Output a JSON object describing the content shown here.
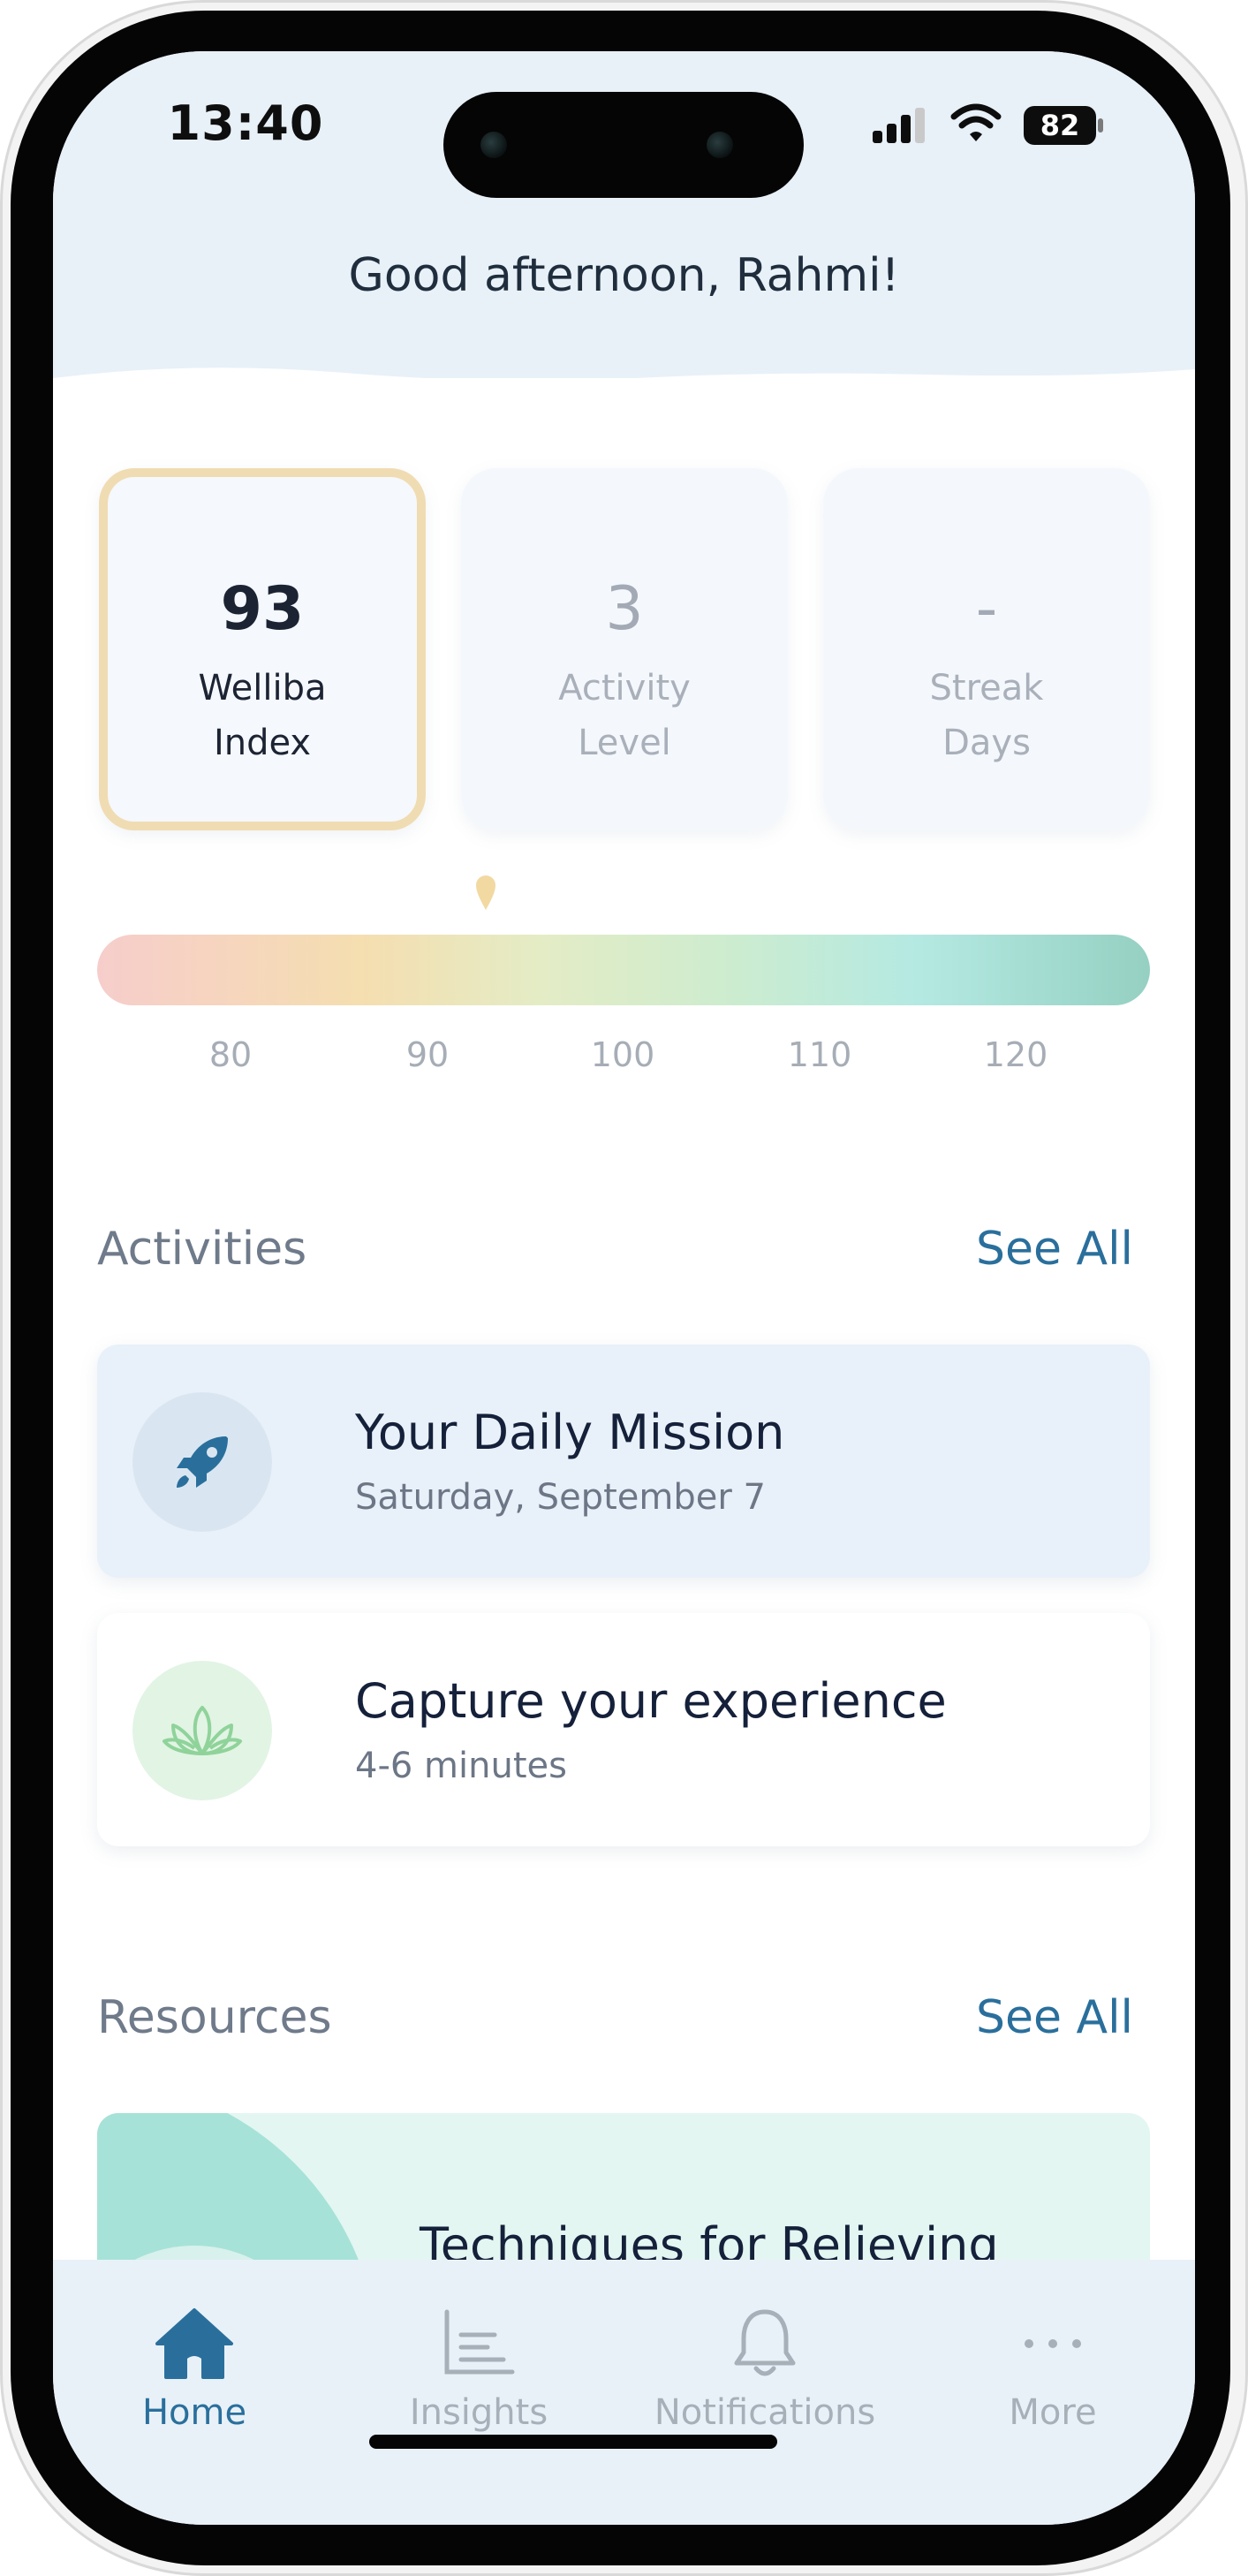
{
  "status_bar": {
    "time": "13:40",
    "battery": "82",
    "icons": [
      "signal-icon",
      "wifi-icon",
      "battery-icon"
    ]
  },
  "greeting": "Good afternoon, Rahmi!",
  "metrics": [
    {
      "value": "93",
      "label_line1": "Welliba",
      "label_line2": "Index",
      "selected": true
    },
    {
      "value": "3",
      "label_line1": "Activity",
      "label_line2": "Level",
      "selected": false
    },
    {
      "value": "-",
      "label_line1": "Streak",
      "label_line2": "Days",
      "selected": false
    }
  ],
  "scale": {
    "ticks": [
      "80",
      "90",
      "100",
      "110",
      "120"
    ],
    "marker_value": 93
  },
  "activities": {
    "title": "Activities",
    "see_all": "See All",
    "items": [
      {
        "title": "Your Daily Mission",
        "subtitle": "Saturday, September 7",
        "icon": "rocket-icon"
      },
      {
        "title": "Capture your experience",
        "subtitle": "4-6 minutes",
        "icon": "lotus-icon"
      }
    ]
  },
  "resources": {
    "title": "Resources",
    "see_all": "See All",
    "items": [
      {
        "title": "Techniques for Relieving"
      }
    ]
  },
  "tabs": [
    {
      "label": "Home",
      "icon": "home-icon",
      "active": true
    },
    {
      "label": "Insights",
      "icon": "insights-icon",
      "active": false
    },
    {
      "label": "Notifications",
      "icon": "bell-icon",
      "active": false
    },
    {
      "label": "More",
      "icon": "more-icon",
      "active": false
    }
  ],
  "colors": {
    "accent": "#2a6f9c",
    "selected_border": "#f0dcb3",
    "header_band": "#e8f1f8"
  }
}
